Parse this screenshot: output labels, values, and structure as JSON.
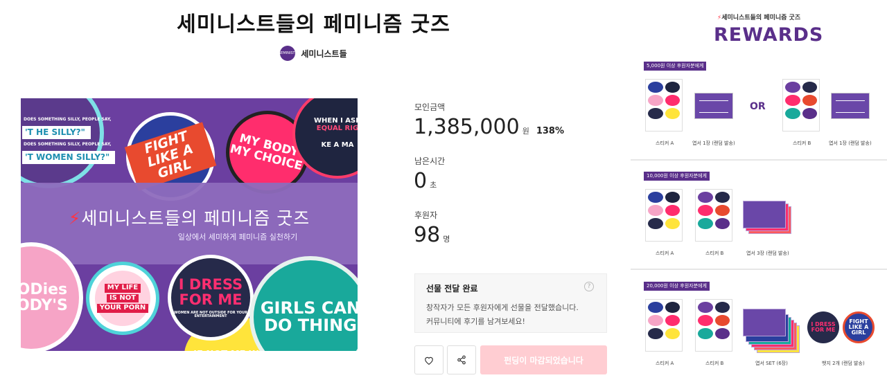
{
  "page": {
    "title": "세미니스트들의 페미니즘 굿즈"
  },
  "creator": {
    "name": "세미니스트들",
    "avatar_text": "SEMINISTS"
  },
  "banner": {
    "title": "세미니스트들의 페미니즘 굿즈",
    "subtitle": "일상에서 세미하게 페미니즘 실천하기",
    "stickers": {
      "quote_1_small": "DOES SOMETHING SILLY, PEOPLE SAY,",
      "quote_1_big": "'T HE SILLY?\"",
      "quote_2_small": "DOES SOMETHING SILLY, PEOPLE SAY,",
      "quote_2_big": "'T WOMEN SILLY?\"",
      "fight": "FIGHT LIKE A GIRL",
      "body": "MY BODY MY CHOICE",
      "ask_1": "WHEN I ASK",
      "ask_2": "EQUAL RIG",
      "ask_3": "KE A MA",
      "life_1": "MY LIFE",
      "life_2": "IS NOT",
      "life_3": "YOUR PORN",
      "dress": "I DRESS FOR ME",
      "dress_small": "WOMEN ARE NOT OUTSIDE FOR YOUR ENTERTAINMENT",
      "girls": "GIRLS CAN DO THING",
      "notme": "IF NOT ME WHO?",
      "pink": "EBODies EBODY'S"
    }
  },
  "stats": {
    "amount_label": "모인금액",
    "amount_value": "1,385,000",
    "amount_unit": "원",
    "amount_percent": "138%",
    "time_label": "남은시간",
    "time_value": "0",
    "time_unit": "초",
    "backers_label": "후원자",
    "backers_value": "98",
    "backers_unit": "명"
  },
  "notice": {
    "title": "선물 전달 완료",
    "line1": "창작자가 모든 후원자에게 선물을 전달했습니다.",
    "line2": "커뮤니티에 후기를 남겨보세요!",
    "help": "?"
  },
  "actions": {
    "main_button": "펀딩이 마감되었습니다"
  },
  "rewards": {
    "subtitle": "세미니스트들의 페미니즘 굿즈",
    "title": "REWARDS",
    "or_label": "OR",
    "tiers": [
      {
        "tag": "5,000원 이상 후원자분에게",
        "captions": [
          "스티커 A",
          "엽서 1장 (랜덤 발송)",
          "스티커 B",
          "엽서 1장 (랜덤 발송)"
        ]
      },
      {
        "tag": "10,000원 이상 후원자분에게",
        "captions": [
          "스티커 A",
          "스티커 B",
          "엽서 3장 (랜덤 발송)"
        ]
      },
      {
        "tag": "20,000원 이상 후원자분에게",
        "captions": [
          "스티커 A",
          "스티커 B",
          "엽서 SET (6장)",
          "뱃지 2개 (랜덤 발송)"
        ]
      }
    ],
    "badges": {
      "dress": "I DRESS FOR ME",
      "fight": "FIGHT LIKE A GIRL"
    }
  },
  "colors": {
    "brand_purple": "#5a2f8a",
    "accent_red": "#ff3344",
    "disabled_button": "#ffcdd2"
  }
}
